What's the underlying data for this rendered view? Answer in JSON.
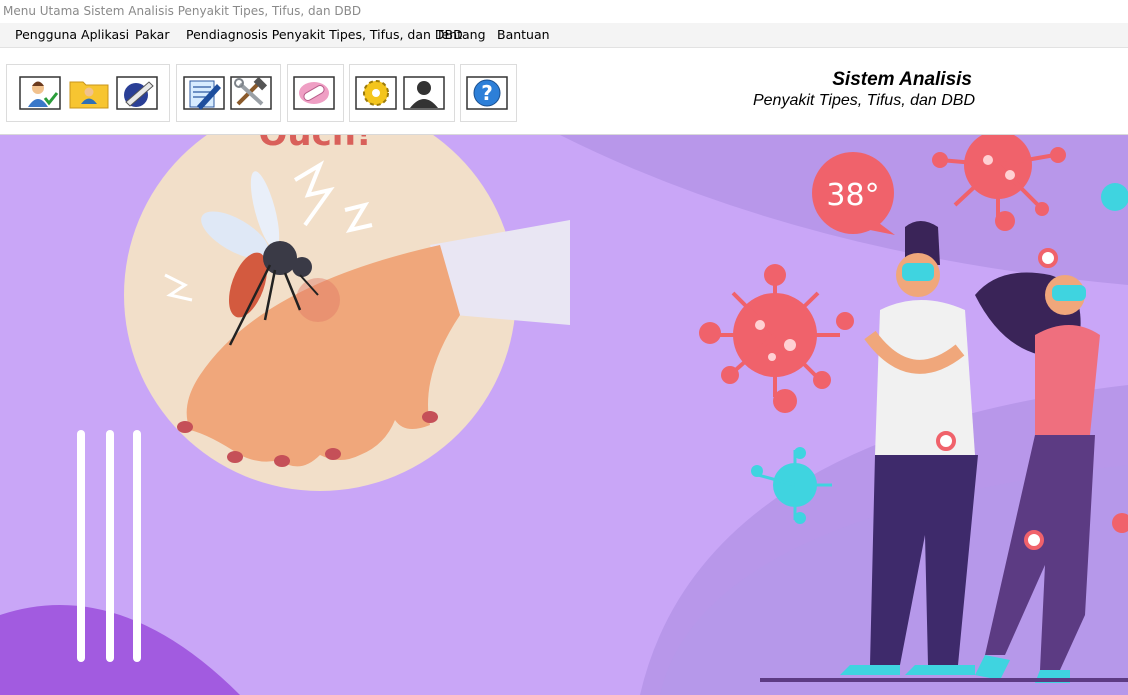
{
  "window": {
    "title": "Menu Utama Sistem Analisis Penyakit Tipes, Tifus, dan DBD"
  },
  "menu": {
    "items": [
      {
        "label": "Pengguna Aplikasi"
      },
      {
        "label": "Pakar"
      },
      {
        "label": "Pendiagnosis Penyakit Tipes, Tifus, dan DBD"
      },
      {
        "label": "Tentang"
      },
      {
        "label": "Bantuan"
      }
    ]
  },
  "toolbar": {
    "buttons": [
      {
        "icon": "user-check-icon"
      },
      {
        "icon": "user-folder-icon"
      },
      {
        "icon": "pen-globe-icon"
      },
      {
        "icon": "notepad-pen-icon"
      },
      {
        "icon": "tools-icon"
      },
      {
        "icon": "pill-icon"
      },
      {
        "icon": "gear-icon"
      },
      {
        "icon": "person-silhouette-icon"
      },
      {
        "icon": "help-icon"
      }
    ]
  },
  "brand": {
    "title": "Sistem Analisis",
    "subtitle": "Penyakit Tipes, Tifus, dan DBD"
  },
  "banner": {
    "exclamation": "Ouch!",
    "temperature": "38°",
    "colors": {
      "background": "#c9a6f7",
      "virus": "#f0626b",
      "virus_cyan": "#3fd4e0",
      "circle": "#f2dfc9"
    }
  }
}
